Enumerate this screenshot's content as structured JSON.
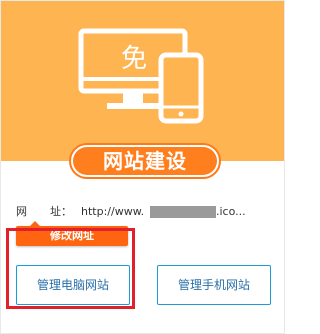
{
  "hero": {
    "icon_char": "免",
    "title": "网站建设"
  },
  "url": {
    "label_part1": "网",
    "label_part2": "址：",
    "prefix": "http://www.",
    "suffix": ".ico..."
  },
  "edit_button": "修改网址",
  "buttons": {
    "manage_pc": "管理电脑网站",
    "manage_mobile": "管理手机网站"
  },
  "colors": {
    "hero_bg": "#ffb452",
    "accent_orange": "#ff7f1f",
    "edit_orange": "#ff6410",
    "button_border": "#1e9ad6",
    "highlight_red": "#e2202c"
  }
}
